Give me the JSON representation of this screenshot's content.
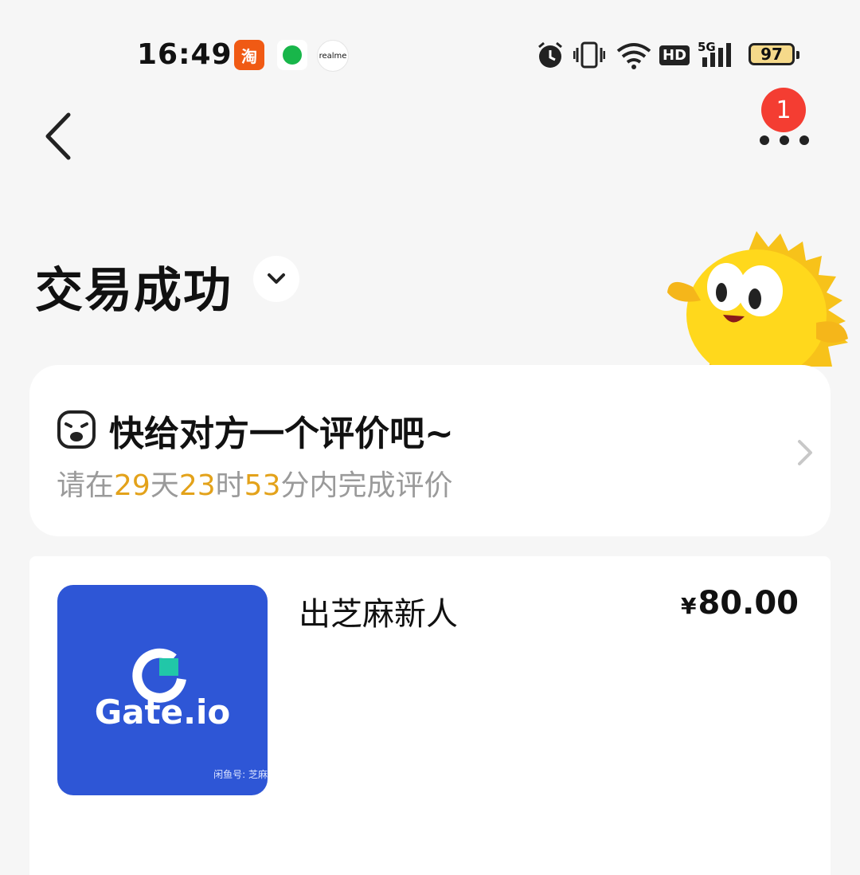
{
  "status_bar": {
    "time": "16:49",
    "notif_taobao": "淘",
    "notif_realme": "realme",
    "network": "5G",
    "hd": "HD",
    "battery": "97"
  },
  "header": {
    "more_badge": "1",
    "title": "交易成功"
  },
  "review": {
    "title": "快给对方一个评价吧~",
    "sub_prefix": "请在",
    "days": "29",
    "days_unit": "天",
    "hours": "23",
    "hours_unit": "时",
    "minutes": "53",
    "minutes_unit": "分内完成评价"
  },
  "product": {
    "title": "出芝麻新人",
    "price_symbol": "¥",
    "price": "80.00",
    "thumb_brand": "Gate.io",
    "thumb_watermark": "闲鱼号: 芝麻"
  },
  "colors": {
    "accent_orange": "#e3a21a",
    "badge_red": "#f43d32",
    "thumb_blue": "#2e56d6"
  },
  "icons": [
    "back-icon",
    "more-icon",
    "chevron-down-icon",
    "emoji-face-icon",
    "chevron-right-icon",
    "alarm-icon",
    "vibrate-icon",
    "wifi-icon",
    "signal-icon"
  ]
}
